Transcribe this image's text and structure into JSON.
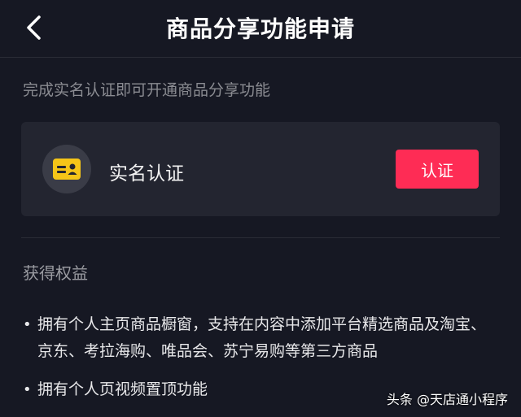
{
  "header": {
    "back_icon": "chevron-left-icon",
    "title": "商品分享功能申请"
  },
  "intro": {
    "text": "完成实名认证即可开通商品分享功能"
  },
  "verify_card": {
    "icon": "id-card-icon",
    "icon_color": "#f5c518",
    "label": "实名认证",
    "button_label": "认证",
    "button_color": "#fe2c55"
  },
  "benefits": {
    "title": "获得权益",
    "items": [
      {
        "bullet": "•",
        "text": "拥有个人主页商品橱窗，支持在内容中添加平台精选商品及淘宝、京东、考拉海购、唯品会、苏宁易购等第三方商品"
      },
      {
        "bullet": "•",
        "text": "拥有个人页视频置顶功能"
      }
    ]
  },
  "watermark": {
    "text": "头条 @天店通小程序"
  }
}
